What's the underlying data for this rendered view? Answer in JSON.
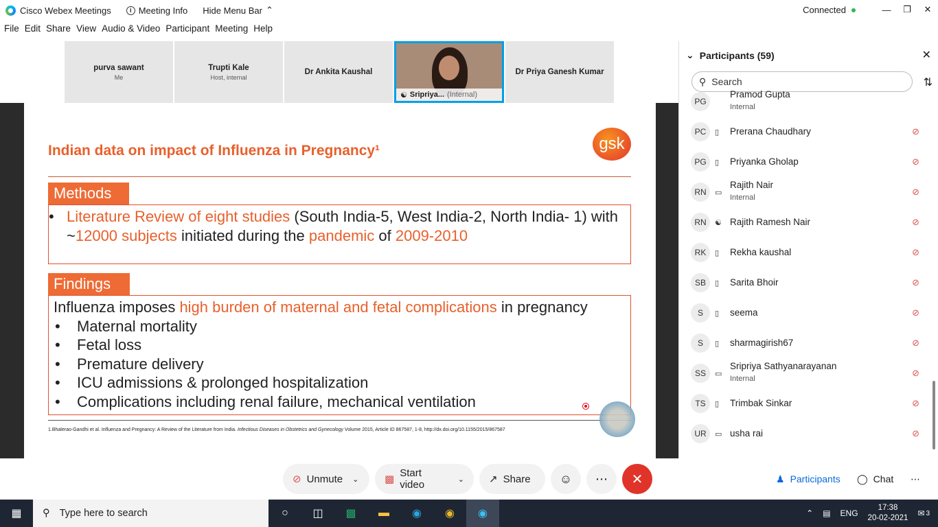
{
  "titlebar": {
    "app_title": "Cisco Webex Meetings",
    "meeting_info": "Meeting Info",
    "hide_menu": "Hide Menu Bar",
    "status": "Connected"
  },
  "menu": [
    "File",
    "Edit",
    "Share",
    "View",
    "Audio & Video",
    "Participant",
    "Meeting",
    "Help"
  ],
  "thumbnails": [
    {
      "name": "purva sawant",
      "sub": "Me"
    },
    {
      "name": "Trupti Kale",
      "sub": "Host, internal"
    },
    {
      "name": "Dr Ankita Kaushal",
      "sub": ""
    },
    {
      "name": "Sripriya...",
      "sub": "(Internal)"
    },
    {
      "name": "Dr Priya Ganesh Kumar",
      "sub": ""
    }
  ],
  "slide": {
    "title": "Indian data on impact of Influenza in Pregnancy¹",
    "logo": "gsk",
    "methods_header": "Methods",
    "methods_bullet": "•",
    "methods": {
      "a": "Literature Review of eight studies",
      "b": " (South India-5, West India-2, North India- 1) with ~",
      "c": "12000 subjects",
      "d": " initiated during the ",
      "e": "pandemic",
      "f": " of ",
      "g": "2009-2010"
    },
    "findings_header": "Findings",
    "findings_intro": {
      "a": "Influenza imposes ",
      "b": "high burden of maternal and fetal complications",
      "c": " in pregnancy"
    },
    "findings": [
      "Maternal mortality",
      "Fetal loss",
      "Premature delivery",
      "ICU admissions & prolonged hospitalization",
      "Complications including renal failure, mechanical ventilation"
    ],
    "footnote": {
      "a": "1.Bhalerao-Gandhi et al. Influenza and Pregnancy: A Review of the Literature from India. ",
      "b": "Infectious Diseases in Obstetrics and Gynecology",
      "c": " Volume 2015, Article ID 867587, 1-8, http://dx.doi.org/10.1155/2015/867587"
    }
  },
  "participants": {
    "title": "Participants (59)",
    "search_placeholder": "Search",
    "list": [
      {
        "initials": "PG",
        "name": "Pramod Gupta",
        "sub": "Internal",
        "device": ""
      },
      {
        "initials": "PC",
        "name": "Prerana Chaudhary",
        "sub": "",
        "device": "phone"
      },
      {
        "initials": "PG",
        "name": "Priyanka Gholap",
        "sub": "",
        "device": "phone"
      },
      {
        "initials": "RN",
        "name": "Rajith Nair",
        "sub": "Internal",
        "device": "desktop"
      },
      {
        "initials": "RN",
        "name": "Rajith Ramesh Nair",
        "sub": "",
        "device": "headset"
      },
      {
        "initials": "RK",
        "name": "Rekha kaushal",
        "sub": "",
        "device": "phone"
      },
      {
        "initials": "SB",
        "name": "Sarita Bhoir",
        "sub": "",
        "device": "phone"
      },
      {
        "initials": "S",
        "name": "seema",
        "sub": "",
        "device": "phone"
      },
      {
        "initials": "S",
        "name": "sharmagirish67",
        "sub": "",
        "device": "phone"
      },
      {
        "initials": "SS",
        "name": "Sripriya Sathyanarayanan",
        "sub": "Internal",
        "device": "desktop"
      },
      {
        "initials": "TS",
        "name": "Trimbak Sinkar",
        "sub": "",
        "device": "phone"
      },
      {
        "initials": "UR",
        "name": "usha rai",
        "sub": "",
        "device": "desktop"
      }
    ]
  },
  "controls": {
    "unmute": "Unmute",
    "start_video": "Start video",
    "share": "Share",
    "participants": "Participants",
    "chat": "Chat"
  },
  "taskbar": {
    "search_placeholder": "Type here to search",
    "lang": "ENG",
    "time": "17:38",
    "date": "20-02-2021",
    "notifications": "3"
  },
  "colors": {
    "accent": "#e8602c",
    "end": "#e0342a",
    "webex_blue": "#00a0e6"
  }
}
